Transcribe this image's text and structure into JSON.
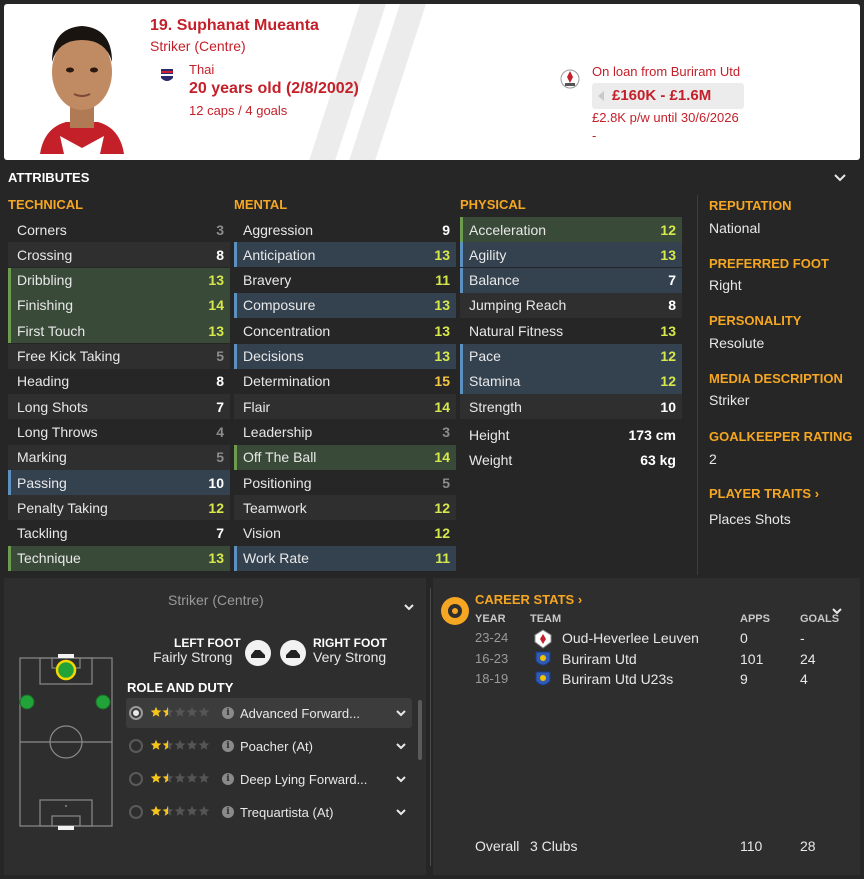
{
  "header": {
    "player_name": "19. Suphanat Mueanta",
    "position": "Striker (Centre)",
    "nationality": "Thai",
    "age": "20 years old (2/8/2002)",
    "caps": "12 caps / 4 goals",
    "loan": "On loan from Buriram Utd",
    "value": "£160K - £1.6M",
    "wage": "£2.8K p/w until 30/6/2026",
    "wage_extra": "-"
  },
  "attributes": {
    "title": "ATTRIBUTES",
    "technical_title": "TECHNICAL",
    "mental_title": "MENTAL",
    "physical_title": "PHYSICAL",
    "technical": [
      {
        "name": "Corners",
        "value": "3"
      },
      {
        "name": "Crossing",
        "value": "8"
      },
      {
        "name": "Dribbling",
        "value": "13"
      },
      {
        "name": "Finishing",
        "value": "14"
      },
      {
        "name": "First Touch",
        "value": "13"
      },
      {
        "name": "Free Kick Taking",
        "value": "5"
      },
      {
        "name": "Heading",
        "value": "8"
      },
      {
        "name": "Long Shots",
        "value": "7"
      },
      {
        "name": "Long Throws",
        "value": "4"
      },
      {
        "name": "Marking",
        "value": "5"
      },
      {
        "name": "Passing",
        "value": "10"
      },
      {
        "name": "Penalty Taking",
        "value": "12"
      },
      {
        "name": "Tackling",
        "value": "7"
      },
      {
        "name": "Technique",
        "value": "13"
      }
    ],
    "mental": [
      {
        "name": "Aggression",
        "value": "9"
      },
      {
        "name": "Anticipation",
        "value": "13"
      },
      {
        "name": "Bravery",
        "value": "11"
      },
      {
        "name": "Composure",
        "value": "13"
      },
      {
        "name": "Concentration",
        "value": "13"
      },
      {
        "name": "Decisions",
        "value": "13"
      },
      {
        "name": "Determination",
        "value": "15"
      },
      {
        "name": "Flair",
        "value": "14"
      },
      {
        "name": "Leadership",
        "value": "3"
      },
      {
        "name": "Off The Ball",
        "value": "14"
      },
      {
        "name": "Positioning",
        "value": "5"
      },
      {
        "name": "Teamwork",
        "value": "12"
      },
      {
        "name": "Vision",
        "value": "12"
      },
      {
        "name": "Work Rate",
        "value": "11"
      }
    ],
    "physical": [
      {
        "name": "Acceleration",
        "value": "12"
      },
      {
        "name": "Agility",
        "value": "13"
      },
      {
        "name": "Balance",
        "value": "7"
      },
      {
        "name": "Jumping Reach",
        "value": "8"
      },
      {
        "name": "Natural Fitness",
        "value": "13"
      },
      {
        "name": "Pace",
        "value": "12"
      },
      {
        "name": "Stamina",
        "value": "12"
      },
      {
        "name": "Strength",
        "value": "10"
      }
    ],
    "height_label": "Height",
    "height_value": "173 cm",
    "weight_label": "Weight",
    "weight_value": "63 kg"
  },
  "side": {
    "reputation_label": "REPUTATION",
    "reputation_value": "National",
    "foot_label": "PREFERRED FOOT",
    "foot_value": "Right",
    "personality_label": "PERSONALITY",
    "personality_value": "Resolute",
    "media_label": "MEDIA DESCRIPTION",
    "media_value": "Striker",
    "gk_label": "GOALKEEPER RATING",
    "gk_value": "2",
    "traits_label": "PLAYER TRAITS",
    "traits_value": "Places Shots"
  },
  "roles": {
    "selected_position": "Striker (Centre)",
    "left_foot_label": "LEFT FOOT",
    "left_foot_value": "Fairly Strong",
    "right_foot_label": "RIGHT FOOT",
    "right_foot_value": "Very Strong",
    "title": "ROLE AND DUTY",
    "items": [
      {
        "name": "Advanced Forward...",
        "stars": 1.5
      },
      {
        "name": "Poacher (At)",
        "stars": 1.5
      },
      {
        "name": "Deep Lying Forward...",
        "stars": 1.5
      },
      {
        "name": "Trequartista (At)",
        "stars": 1.5
      }
    ]
  },
  "career": {
    "title": "CAREER STATS",
    "col_year": "YEAR",
    "col_team": "TEAM",
    "col_apps": "APPS",
    "col_goals": "GOALS",
    "rows": [
      {
        "year": "23-24",
        "team": "Oud-Heverlee Leuven",
        "apps": "0",
        "goals": "-"
      },
      {
        "year": "16-23",
        "team": "Buriram Utd",
        "apps": "101",
        "goals": "24"
      },
      {
        "year": "18-19",
        "team": "Buriram Utd U23s",
        "apps": "9",
        "goals": "4"
      }
    ],
    "overall_label": "Overall",
    "overall_clubs": "3 Clubs",
    "overall_apps": "110",
    "overall_goals": "28"
  },
  "colors": {
    "accent": "#f5a623",
    "header_text": "#c4202a",
    "highlight_green": "#3a4a39",
    "highlight_blue": "#344250"
  }
}
